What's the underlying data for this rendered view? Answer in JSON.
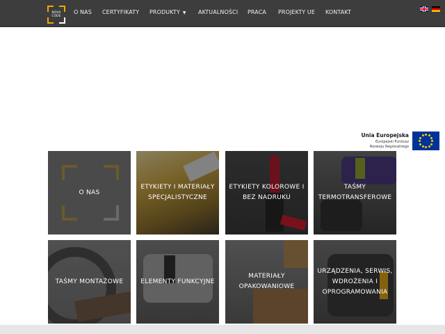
{
  "nav": {
    "logo_text": "NOVA\nCODE",
    "items": [
      {
        "label": "O NAS"
      },
      {
        "label": "CERTYFIKATY"
      },
      {
        "label": "PRODUKTY",
        "caret": "▼"
      },
      {
        "label": "AKTUALNOŚCI"
      },
      {
        "label": "PRACA"
      },
      {
        "label": "PROJEKTY UE"
      },
      {
        "label": "KONTAKT"
      }
    ],
    "languages": [
      "en",
      "de"
    ]
  },
  "eu_badge": {
    "title": "Unia Europejska",
    "subtitle_line1": "Europejski Fundusz",
    "subtitle_line2": "Rozwoju Regionalnego"
  },
  "tiles": [
    {
      "label": "O NAS"
    },
    {
      "label": "ETYKIETY I MATERIAŁY SPECJALISTYCZNE"
    },
    {
      "label": "ETYKIETY KOLOROWE I BEZ NADRUKU"
    },
    {
      "label": "TAŚMY TERMOTRANSFEROWE"
    },
    {
      "label": "TAŚMY MONTAŻOWE"
    },
    {
      "label": "ELEMENTY FUNKCYJNE"
    },
    {
      "label": "MATERIAŁY OPAKOWANIOWE"
    },
    {
      "label": "URZĄDZENIA, SERWIS, WDROŻENIA I OPROGRAMOWANIA"
    }
  ],
  "colors": {
    "nav_bg": "#3d3d3d",
    "accent": "#f2a900",
    "eu_blue": "#003399"
  }
}
